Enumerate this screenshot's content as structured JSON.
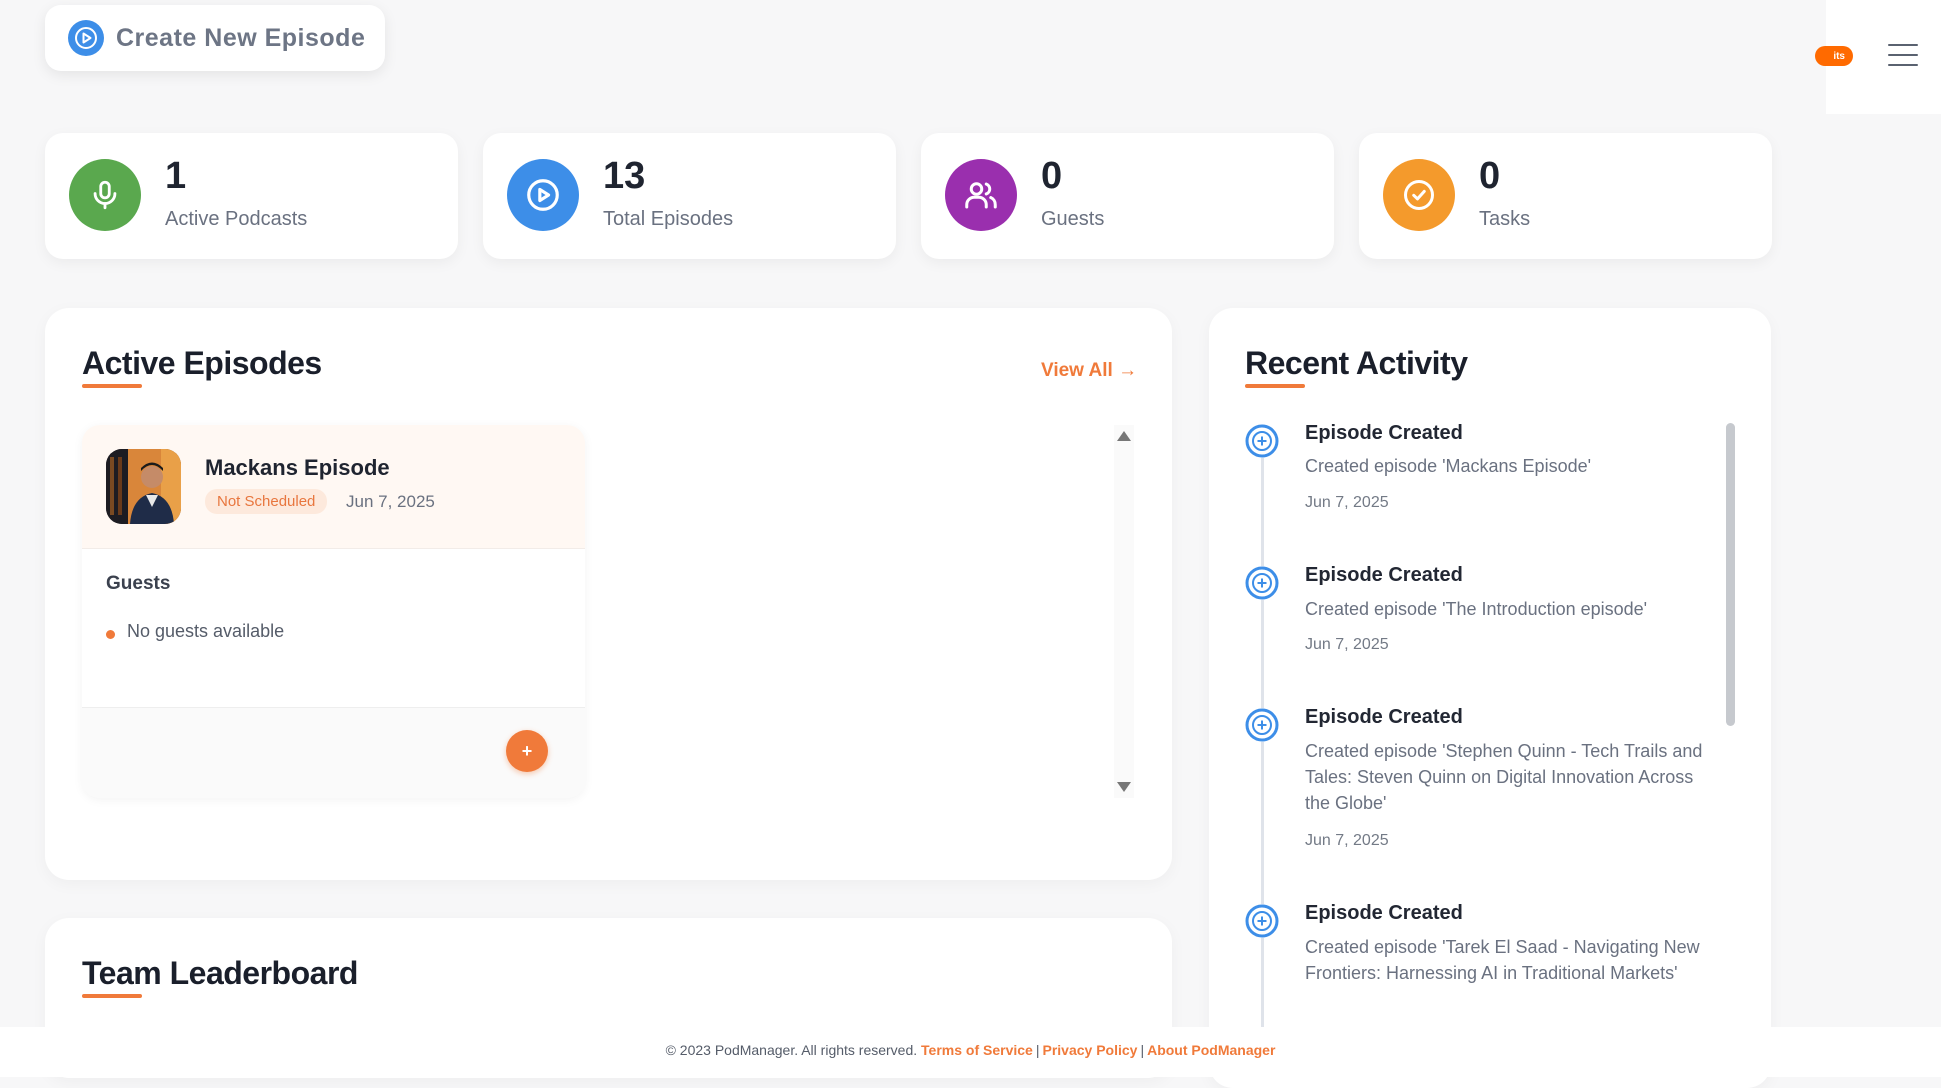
{
  "header": {
    "create_label": "Create New Episode",
    "credits_badge": "its"
  },
  "stats": [
    {
      "value": "1",
      "label": "Active Podcasts",
      "color": "#5aa84e",
      "icon": "microphone-icon"
    },
    {
      "value": "13",
      "label": "Total Episodes",
      "color": "#3d8ee8",
      "icon": "play-circle-icon"
    },
    {
      "value": "0",
      "label": "Guests",
      "color": "#9a2fae",
      "icon": "users-icon"
    },
    {
      "value": "0",
      "label": "Tasks",
      "color": "#f49a2c",
      "icon": "check-circle-icon"
    }
  ],
  "active_episodes": {
    "title": "Active Episodes",
    "view_all": "View All →",
    "episode": {
      "title": "Mackans Episode",
      "status": "Not Scheduled",
      "date": "Jun 7, 2025",
      "guests_heading": "Guests",
      "no_guests": "No guests available",
      "add_label": "+"
    }
  },
  "leaderboard": {
    "title": "Team Leaderboard"
  },
  "recent_activity": {
    "title": "Recent Activity",
    "items": [
      {
        "title": "Episode Created",
        "desc": "Created episode 'Mackans Episode'",
        "date": "Jun 7, 2025"
      },
      {
        "title": "Episode Created",
        "desc": "Created episode 'The Introduction episode'",
        "date": "Jun 7, 2025"
      },
      {
        "title": "Episode Created",
        "desc": "Created episode 'Stephen Quinn - Tech Trails and Tales: Steven Quinn on Digital Innovation Across the Globe'",
        "date": "Jun 7, 2025"
      },
      {
        "title": "Episode Created",
        "desc": "Created episode 'Tarek El Saad - Navigating New Frontiers: Harnessing AI in Traditional Markets'",
        "date": ""
      }
    ]
  },
  "footer": {
    "copyright": "© 2023 PodManager. All rights reserved.",
    "terms": "Terms of Service",
    "privacy": "Privacy Policy",
    "about": "About PodManager",
    "separator": "|"
  },
  "colors": {
    "accent": "#f07a3a",
    "blue": "#3d8ee8"
  }
}
